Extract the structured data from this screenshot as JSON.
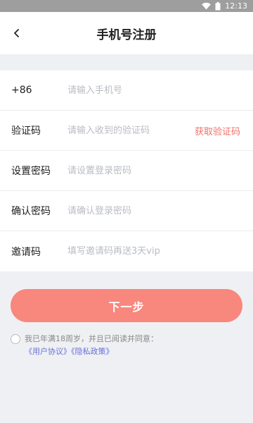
{
  "status_bar": {
    "time": "12:13",
    "icons": [
      "wifi-icon",
      "battery-icon"
    ]
  },
  "header": {
    "title": "手机号注册",
    "back_icon": "back-arrow-icon"
  },
  "form": {
    "phone": {
      "label": "+86",
      "placeholder": "请输入手机号"
    },
    "code": {
      "label": "验证码",
      "placeholder": "请输入收到的验证码",
      "action": "获取验证码"
    },
    "password": {
      "label": "设置密码",
      "placeholder": "请设置登录密码"
    },
    "confirm": {
      "label": "确认密码",
      "placeholder": "请确认登录密码"
    },
    "invite": {
      "label": "邀请码",
      "placeholder": "填写邀请码再送3天vip"
    }
  },
  "next_button": {
    "label": "下一步"
  },
  "agreement": {
    "text": "我已年满18周岁，并且已阅读并同意：",
    "user_agreement": "《用户协议》",
    "privacy_policy": "《隐私政策》"
  },
  "colors": {
    "accent": "#f8877e",
    "link": "#6a6fd8",
    "code_action": "#f0726a"
  }
}
